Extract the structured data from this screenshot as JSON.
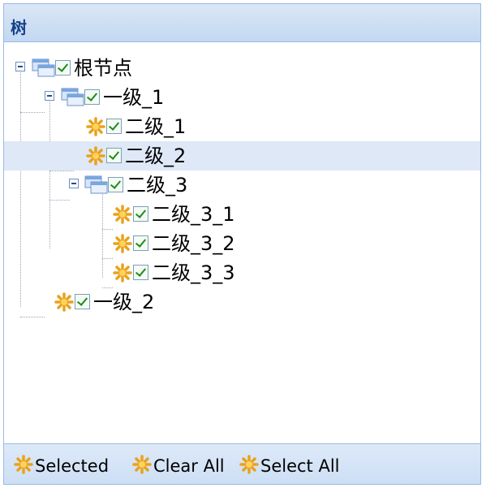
{
  "panel": {
    "title": "树"
  },
  "tree": {
    "root": {
      "label": "根节点"
    },
    "level1_1": {
      "label": "一级_1"
    },
    "level2_1": {
      "label": "二级_1"
    },
    "level2_2": {
      "label": "二级_2",
      "selected": true
    },
    "level2_3": {
      "label": "二级_3"
    },
    "level3_1": {
      "label": "二级_3_1"
    },
    "level3_2": {
      "label": "二级_3_2"
    },
    "level3_3": {
      "label": "二级_3_3"
    },
    "level1_2": {
      "label": "一级_2"
    }
  },
  "toolbar": {
    "selected_label": "Selected",
    "clear_all_label": "Clear All",
    "select_all_label": "Select All"
  },
  "colors": {
    "selection_bg": "#dfe8f6",
    "header_text": "#15428b",
    "border": "#99bbe8"
  }
}
